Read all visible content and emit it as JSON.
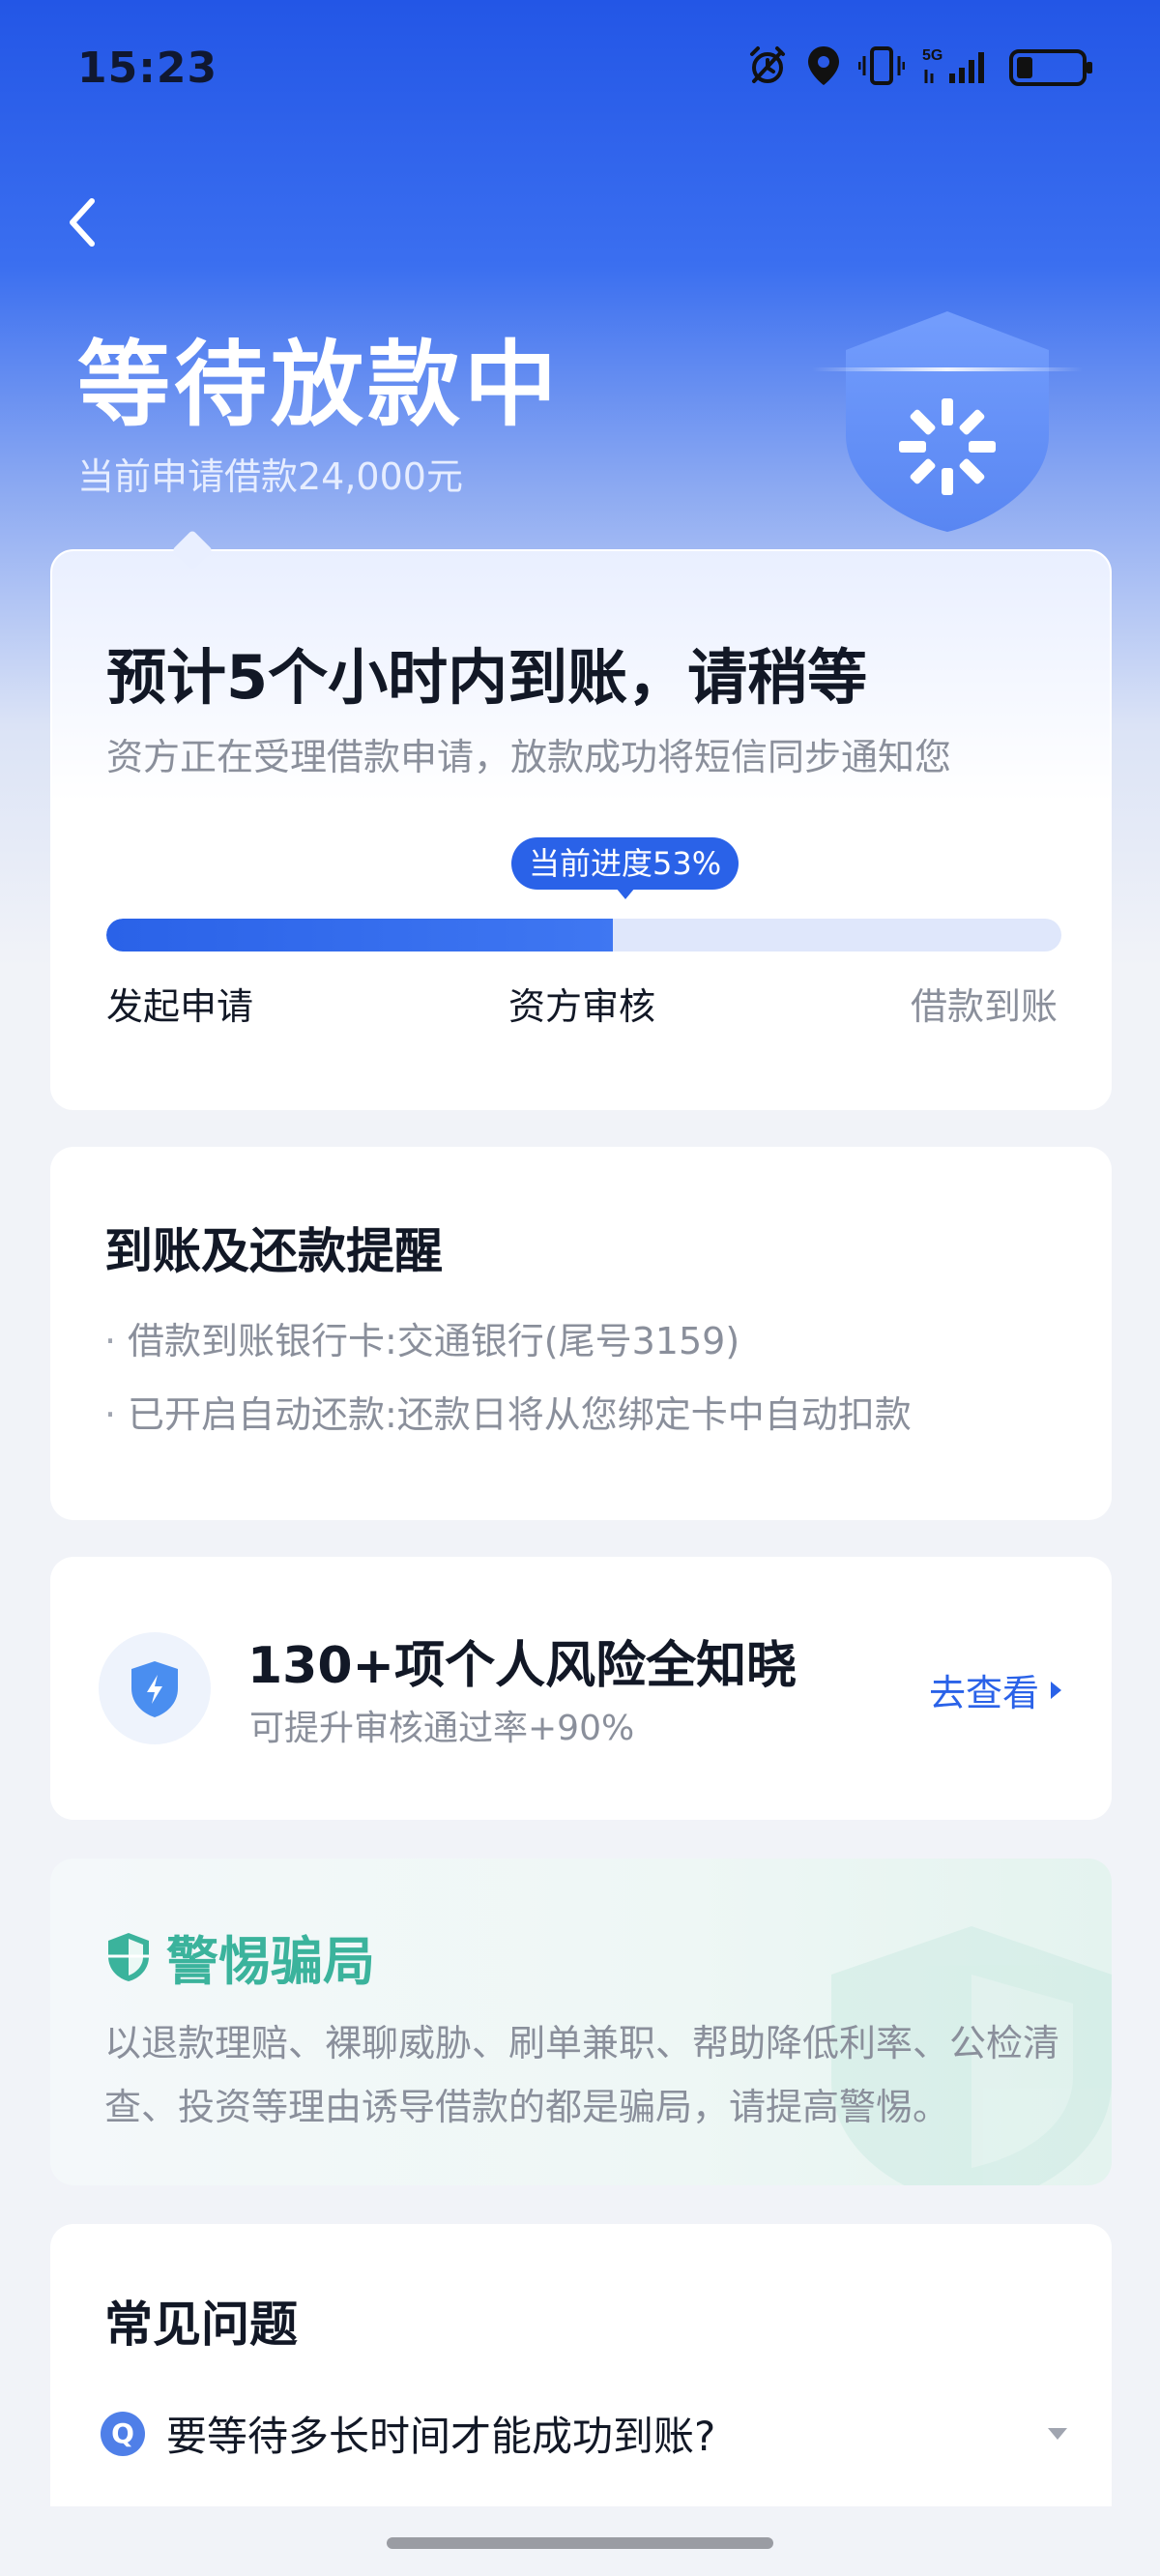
{
  "status_bar": {
    "time": "15:23",
    "icons": [
      "alarm-icon",
      "location-icon",
      "vibrate-icon",
      "5g-signal-icon",
      "battery-icon"
    ],
    "network": "5G"
  },
  "header": {
    "back_icon": "chevron-left-icon",
    "title": "等待放款中",
    "subtitle": "当前申请借款24,000元"
  },
  "progress_card": {
    "title": "预计5个小时内到账，请稍等",
    "description": "资方正在受理借款申请，放款成功将短信同步通知您",
    "badge": "当前进度53%",
    "progress_percent": 53,
    "steps": [
      "发起申请",
      "资方审核",
      "借款到账"
    ]
  },
  "reminder_card": {
    "title": "到账及还款提醒",
    "items": [
      "借款到账银行卡:交通银行(尾号3159)",
      "已开启自动还款:还款日将从您绑定卡中自动扣款"
    ]
  },
  "risk_card": {
    "title": "130+项个人风险全知晓",
    "subtitle": "可提升审核通过率+90%",
    "link": "去查看"
  },
  "warning_card": {
    "title": "警惕骗局",
    "body": "以退款理赔、裸聊威胁、刷单兼职、帮助降低利率、公检清查、投资等理由诱导借款的都是骗局，请提高警惕。"
  },
  "faq_card": {
    "title": "常见问题",
    "q_badge": "Q",
    "question": "要等待多长时间才能成功到账?"
  },
  "colors": {
    "primary": "#2a62e8",
    "hero_top": "#2356e6",
    "warning": "#3bb39c",
    "muted_text": "#8a8f9b"
  }
}
